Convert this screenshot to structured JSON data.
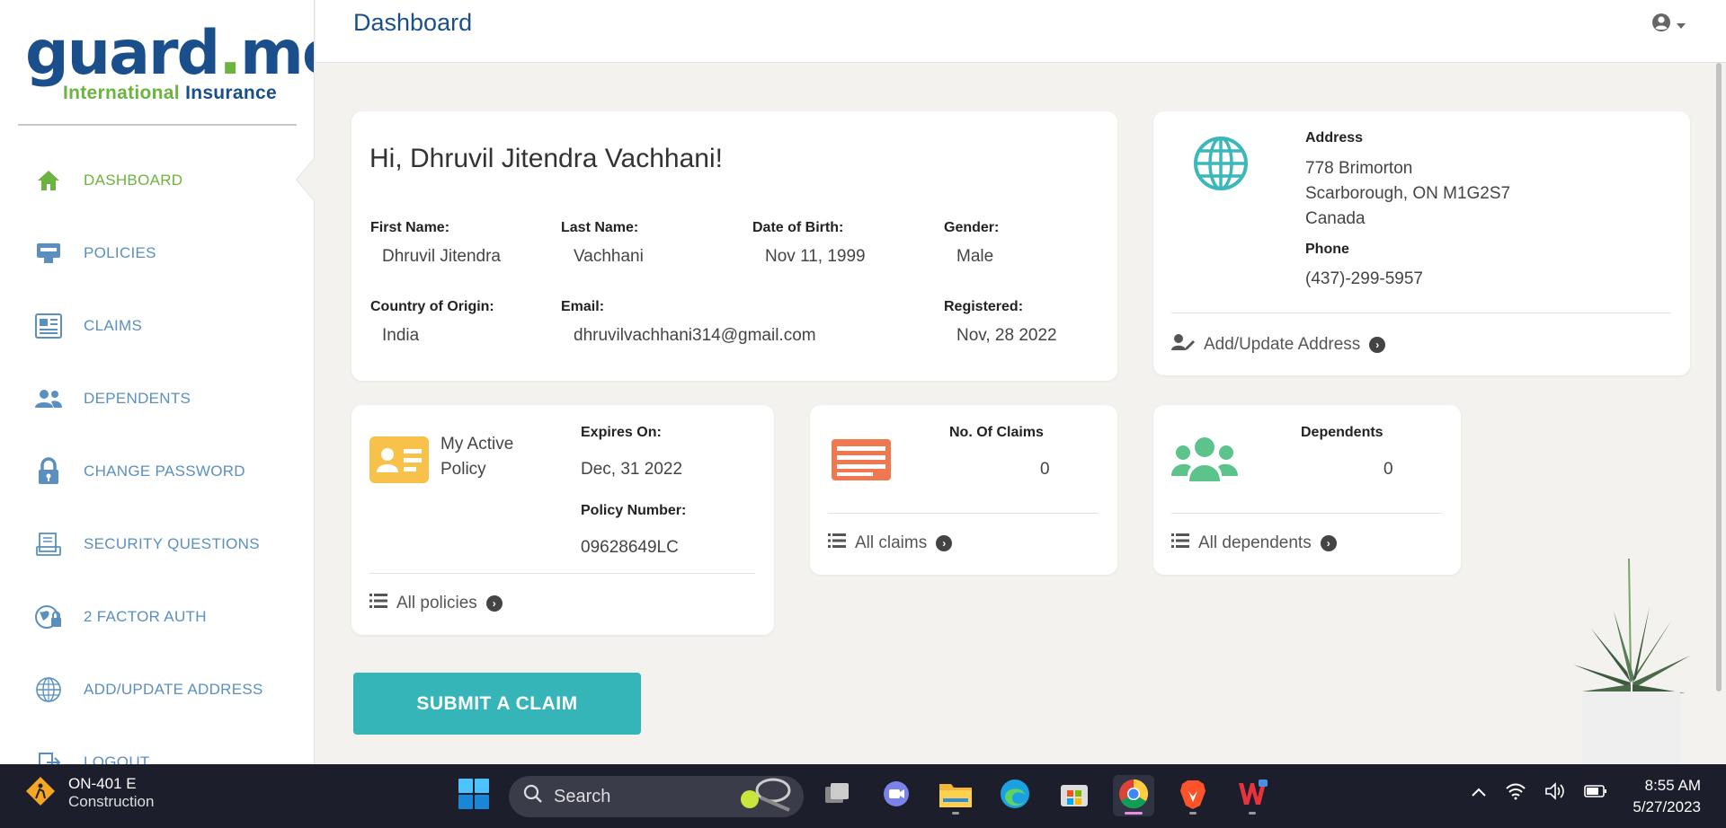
{
  "logo": {
    "brand": "guard.me",
    "brand_part1": "guard",
    "brand_dot": ".",
    "brand_part2": "me",
    "reg": "®",
    "tag1": "International",
    "tag2": "Insurance"
  },
  "sidebar": {
    "items": [
      {
        "label": "DASHBOARD",
        "icon": "home-icon",
        "active": true
      },
      {
        "label": "POLICIES",
        "icon": "policies-icon"
      },
      {
        "label": "CLAIMS",
        "icon": "claims-icon"
      },
      {
        "label": "DEPENDENTS",
        "icon": "people-icon"
      },
      {
        "label": "CHANGE PASSWORD",
        "icon": "lock-icon"
      },
      {
        "label": "SECURITY QUESTIONS",
        "icon": "security-questions-icon"
      },
      {
        "label": "2 FACTOR AUTH",
        "icon": "two-factor-icon"
      },
      {
        "label": "ADD/UPDATE ADDRESS",
        "icon": "globe-icon"
      },
      {
        "label": "LOGOUT",
        "icon": "logout-icon"
      }
    ]
  },
  "header": {
    "title": "Dashboard",
    "user_icon": "user-circle-icon"
  },
  "profile": {
    "greeting": "Hi, Dhruvil Jitendra Vachhani!",
    "first_name_label": "First Name:",
    "first_name": "Dhruvil Jitendra",
    "last_name_label": "Last Name:",
    "last_name": "Vachhani",
    "dob_label": "Date of Birth:",
    "dob": "Nov 11, 1999",
    "gender_label": "Gender:",
    "gender": "Male",
    "country_label": "Country of Origin:",
    "country": "India",
    "email_label": "Email:",
    "email": "dhruvilvachhani314@gmail.com",
    "registered_label": "Registered:",
    "registered": "Nov, 28 2022"
  },
  "address": {
    "address_label": "Address",
    "line1": "778 Brimorton",
    "line2": "Scarborough, ON M1G2S7",
    "line3": "Canada",
    "phone_label": "Phone",
    "phone": "(437)-299-5957",
    "update_link": "Add/Update Address"
  },
  "policy": {
    "title_line1": "My Active",
    "title_line2": "Policy",
    "expires_label": "Expires On:",
    "expires": "Dec, 31 2022",
    "number_label": "Policy Number:",
    "number": "09628649LC",
    "link": "All policies"
  },
  "claims": {
    "label": "No. Of Claims",
    "count": "0",
    "link": "All claims"
  },
  "dependents": {
    "label": "Dependents",
    "count": "0",
    "link": "All dependents"
  },
  "submit": {
    "label": "SUBMIT A CLAIM"
  },
  "colors": {
    "brand_blue": "#1b4f8c",
    "brand_green": "#6cb33f",
    "teal": "#35b5b8",
    "orange": "#f07850",
    "yellow": "#f8c24a",
    "mint": "#5cc48b"
  },
  "taskbar": {
    "weather_title": "ON-401 E",
    "weather_sub": "Construction",
    "search_placeholder": "Search",
    "time": "8:55 AM",
    "date": "5/27/2023"
  }
}
